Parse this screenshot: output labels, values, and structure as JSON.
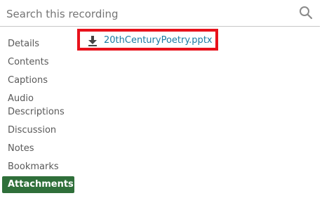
{
  "search": {
    "placeholder": "Search this recording",
    "value": ""
  },
  "sidebar": {
    "items": [
      {
        "label": "Details"
      },
      {
        "label": "Contents"
      },
      {
        "label": "Captions"
      },
      {
        "label": "Audio Descriptions"
      },
      {
        "label": "Discussion"
      },
      {
        "label": "Notes"
      },
      {
        "label": "Bookmarks"
      },
      {
        "label": "Attachments",
        "active": true
      }
    ]
  },
  "attachments": {
    "items": [
      {
        "filename": "20thCenturyPoetry.pptx",
        "icon": "download-icon"
      }
    ]
  },
  "colors": {
    "active_tab_bg": "#2f6f3a",
    "link": "#1a7ba3",
    "highlight_border": "#e8121c"
  }
}
